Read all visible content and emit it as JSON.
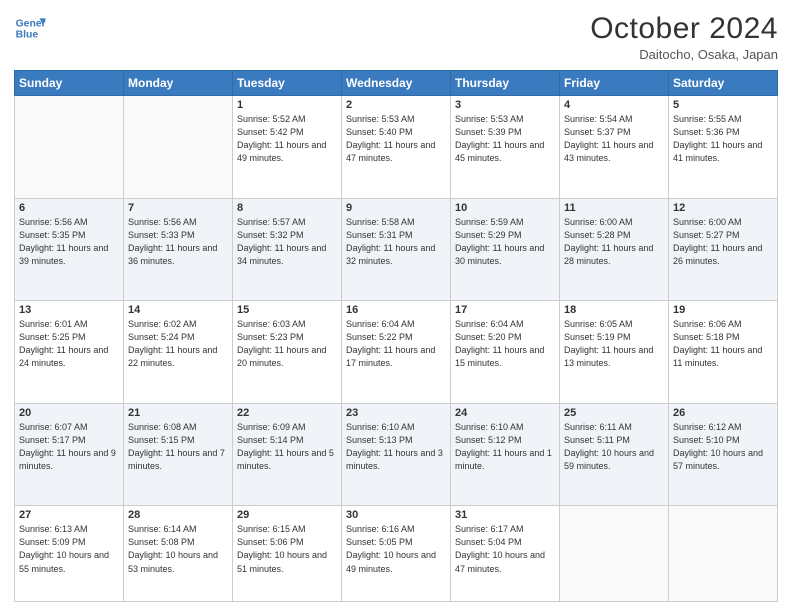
{
  "header": {
    "logo": {
      "line1": "General",
      "line2": "Blue"
    },
    "title": "October 2024",
    "subtitle": "Daitocho, Osaka, Japan"
  },
  "calendar": {
    "weekdays": [
      "Sunday",
      "Monday",
      "Tuesday",
      "Wednesday",
      "Thursday",
      "Friday",
      "Saturday"
    ],
    "rows": [
      [
        {
          "day": "",
          "content": ""
        },
        {
          "day": "",
          "content": ""
        },
        {
          "day": "1",
          "content": "Sunrise: 5:52 AM\nSunset: 5:42 PM\nDaylight: 11 hours and 49 minutes."
        },
        {
          "day": "2",
          "content": "Sunrise: 5:53 AM\nSunset: 5:40 PM\nDaylight: 11 hours and 47 minutes."
        },
        {
          "day": "3",
          "content": "Sunrise: 5:53 AM\nSunset: 5:39 PM\nDaylight: 11 hours and 45 minutes."
        },
        {
          "day": "4",
          "content": "Sunrise: 5:54 AM\nSunset: 5:37 PM\nDaylight: 11 hours and 43 minutes."
        },
        {
          "day": "5",
          "content": "Sunrise: 5:55 AM\nSunset: 5:36 PM\nDaylight: 11 hours and 41 minutes."
        }
      ],
      [
        {
          "day": "6",
          "content": "Sunrise: 5:56 AM\nSunset: 5:35 PM\nDaylight: 11 hours and 39 minutes."
        },
        {
          "day": "7",
          "content": "Sunrise: 5:56 AM\nSunset: 5:33 PM\nDaylight: 11 hours and 36 minutes."
        },
        {
          "day": "8",
          "content": "Sunrise: 5:57 AM\nSunset: 5:32 PM\nDaylight: 11 hours and 34 minutes."
        },
        {
          "day": "9",
          "content": "Sunrise: 5:58 AM\nSunset: 5:31 PM\nDaylight: 11 hours and 32 minutes."
        },
        {
          "day": "10",
          "content": "Sunrise: 5:59 AM\nSunset: 5:29 PM\nDaylight: 11 hours and 30 minutes."
        },
        {
          "day": "11",
          "content": "Sunrise: 6:00 AM\nSunset: 5:28 PM\nDaylight: 11 hours and 28 minutes."
        },
        {
          "day": "12",
          "content": "Sunrise: 6:00 AM\nSunset: 5:27 PM\nDaylight: 11 hours and 26 minutes."
        }
      ],
      [
        {
          "day": "13",
          "content": "Sunrise: 6:01 AM\nSunset: 5:25 PM\nDaylight: 11 hours and 24 minutes."
        },
        {
          "day": "14",
          "content": "Sunrise: 6:02 AM\nSunset: 5:24 PM\nDaylight: 11 hours and 22 minutes."
        },
        {
          "day": "15",
          "content": "Sunrise: 6:03 AM\nSunset: 5:23 PM\nDaylight: 11 hours and 20 minutes."
        },
        {
          "day": "16",
          "content": "Sunrise: 6:04 AM\nSunset: 5:22 PM\nDaylight: 11 hours and 17 minutes."
        },
        {
          "day": "17",
          "content": "Sunrise: 6:04 AM\nSunset: 5:20 PM\nDaylight: 11 hours and 15 minutes."
        },
        {
          "day": "18",
          "content": "Sunrise: 6:05 AM\nSunset: 5:19 PM\nDaylight: 11 hours and 13 minutes."
        },
        {
          "day": "19",
          "content": "Sunrise: 6:06 AM\nSunset: 5:18 PM\nDaylight: 11 hours and 11 minutes."
        }
      ],
      [
        {
          "day": "20",
          "content": "Sunrise: 6:07 AM\nSunset: 5:17 PM\nDaylight: 11 hours and 9 minutes."
        },
        {
          "day": "21",
          "content": "Sunrise: 6:08 AM\nSunset: 5:15 PM\nDaylight: 11 hours and 7 minutes."
        },
        {
          "day": "22",
          "content": "Sunrise: 6:09 AM\nSunset: 5:14 PM\nDaylight: 11 hours and 5 minutes."
        },
        {
          "day": "23",
          "content": "Sunrise: 6:10 AM\nSunset: 5:13 PM\nDaylight: 11 hours and 3 minutes."
        },
        {
          "day": "24",
          "content": "Sunrise: 6:10 AM\nSunset: 5:12 PM\nDaylight: 11 hours and 1 minute."
        },
        {
          "day": "25",
          "content": "Sunrise: 6:11 AM\nSunset: 5:11 PM\nDaylight: 10 hours and 59 minutes."
        },
        {
          "day": "26",
          "content": "Sunrise: 6:12 AM\nSunset: 5:10 PM\nDaylight: 10 hours and 57 minutes."
        }
      ],
      [
        {
          "day": "27",
          "content": "Sunrise: 6:13 AM\nSunset: 5:09 PM\nDaylight: 10 hours and 55 minutes."
        },
        {
          "day": "28",
          "content": "Sunrise: 6:14 AM\nSunset: 5:08 PM\nDaylight: 10 hours and 53 minutes."
        },
        {
          "day": "29",
          "content": "Sunrise: 6:15 AM\nSunset: 5:06 PM\nDaylight: 10 hours and 51 minutes."
        },
        {
          "day": "30",
          "content": "Sunrise: 6:16 AM\nSunset: 5:05 PM\nDaylight: 10 hours and 49 minutes."
        },
        {
          "day": "31",
          "content": "Sunrise: 6:17 AM\nSunset: 5:04 PM\nDaylight: 10 hours and 47 minutes."
        },
        {
          "day": "",
          "content": ""
        },
        {
          "day": "",
          "content": ""
        }
      ]
    ]
  }
}
